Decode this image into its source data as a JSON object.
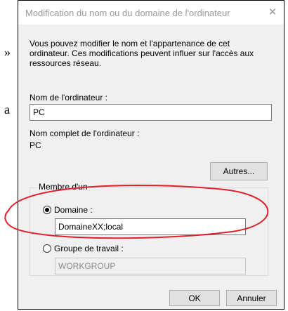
{
  "page_fragments": {
    "quote_char": "»",
    "letter": "a"
  },
  "dialog": {
    "title": "Modification du nom ou du domaine de l'ordinateur",
    "description": "Vous pouvez modifier le nom et l'appartenance de cet ordinateur. Ces modifications peuvent influer sur l'accès aux ressources réseau.",
    "computer_name_label": "Nom de l'ordinateur :",
    "computer_name_value": "PC",
    "full_name_label": "Nom complet de l'ordinateur :",
    "full_name_value": "PC",
    "more_button": "Autres...",
    "membership_title": "Membre d'un",
    "domain_label": "Domaine :",
    "domain_value": "DomaineXX;local",
    "domain_selected": true,
    "workgroup_label": "Groupe de travail :",
    "workgroup_value": "WORKGROUP",
    "ok_button": "OK",
    "cancel_button": "Annuler"
  },
  "colors": {
    "annotation": "#e0202a",
    "dialog_bg": "#f0f0f0"
  },
  "icons": {
    "close": "close-icon",
    "radio_selected": "radio-selected-icon",
    "radio_empty": "radio-empty-icon"
  }
}
